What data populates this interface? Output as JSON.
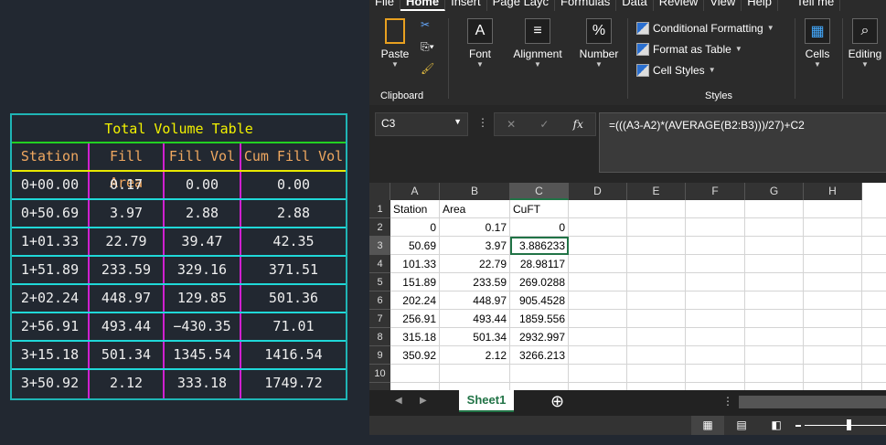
{
  "cad_table": {
    "title": "Total Volume Table",
    "headers": [
      "Station",
      "Fill Area",
      "Fill Vol",
      "Cum Fill Vol"
    ],
    "rows": [
      [
        "0+00.00",
        "0.17",
        "0.00",
        "0.00"
      ],
      [
        "0+50.69",
        "3.97",
        "2.88",
        "2.88"
      ],
      [
        "1+01.33",
        "22.79",
        "39.47",
        "42.35"
      ],
      [
        "1+51.89",
        "233.59",
        "329.16",
        "371.51"
      ],
      [
        "2+02.24",
        "448.97",
        "129.85",
        "501.36"
      ],
      [
        "2+56.91",
        "493.44",
        "−430.35",
        "71.01"
      ],
      [
        "3+15.18",
        "501.34",
        "1345.54",
        "1416.54"
      ],
      [
        "3+50.92",
        "2.12",
        "333.18",
        "1749.72"
      ]
    ]
  },
  "excel": {
    "tabs": [
      "File",
      "Home",
      "Insert",
      "Page Layc",
      "Formulas",
      "Data",
      "Review",
      "View",
      "Help",
      "Tell me"
    ],
    "ribbon": {
      "paste": "Paste",
      "clipboard": "Clipboard",
      "font": "Font",
      "font_glyph": "A",
      "alignment": "Alignment",
      "alignment_glyph": "≡",
      "number": "Number",
      "number_glyph": "%",
      "conditional": "Conditional Formatting",
      "format_table": "Format as Table",
      "cell_styles": "Cell Styles",
      "styles": "Styles",
      "cells": "Cells",
      "editing": "Editing"
    },
    "name_box": "C3",
    "fx": "fx",
    "formula": "=(((A3-A2)*(AVERAGE(B2:B3)))/27)+C2",
    "columns": [
      "A",
      "B",
      "C",
      "D",
      "E",
      "F",
      "G",
      "H"
    ],
    "row_numbers": [
      "1",
      "2",
      "3",
      "4",
      "5",
      "6",
      "7",
      "8",
      "9",
      "10"
    ],
    "cells": [
      [
        "Station",
        "Area",
        "CuFT"
      ],
      [
        "0",
        "0.17",
        "0"
      ],
      [
        "50.69",
        "3.97",
        "3.886233"
      ],
      [
        "101.33",
        "22.79",
        "28.98117"
      ],
      [
        "151.89",
        "233.59",
        "269.0288"
      ],
      [
        "202.24",
        "448.97",
        "905.4528"
      ],
      [
        "256.91",
        "493.44",
        "1859.556"
      ],
      [
        "315.18",
        "501.34",
        "2932.997"
      ],
      [
        "350.92",
        "2.12",
        "3266.213"
      ]
    ],
    "sheet_tab": "Sheet1"
  }
}
